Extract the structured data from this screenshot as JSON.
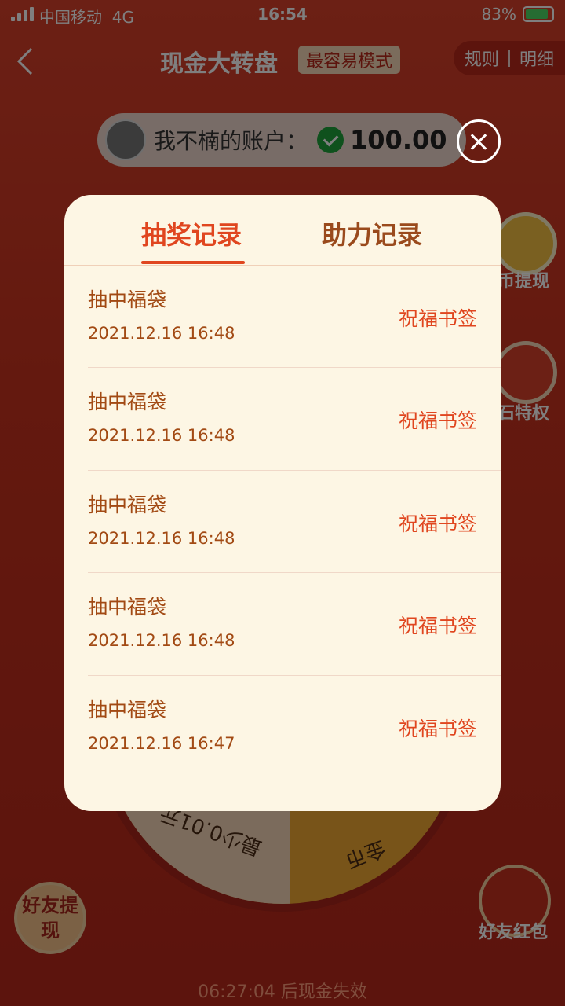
{
  "status_bar": {
    "carrier": "中国移动",
    "network": "4G",
    "time": "16:54",
    "battery": "83%"
  },
  "nav": {
    "title": "现金大转盘",
    "mode_badge": "最容易模式",
    "rules": "规则",
    "details": "明细"
  },
  "account": {
    "label": "我不楠的账户：",
    "amount": "100.00"
  },
  "background": {
    "side_label_1": "币提现",
    "side_label_2": "石特权",
    "wheel_text_1": "最少0.01元",
    "wheel_text_2": "金币",
    "friend_withdraw": "好友提现",
    "friend_redpack": "好友红包",
    "countdown": "06:27:04 后现金失效"
  },
  "modal": {
    "tabs": [
      "抽奖记录",
      "助力记录"
    ],
    "records": [
      {
        "title": "抽中福袋",
        "time": "2021.12.16 16:48",
        "prize": "祝福书签"
      },
      {
        "title": "抽中福袋",
        "time": "2021.12.16 16:48",
        "prize": "祝福书签"
      },
      {
        "title": "抽中福袋",
        "time": "2021.12.16 16:48",
        "prize": "祝福书签"
      },
      {
        "title": "抽中福袋",
        "time": "2021.12.16 16:48",
        "prize": "祝福书签"
      },
      {
        "title": "抽中福袋",
        "time": "2021.12.16 16:47",
        "prize": "祝福书签"
      }
    ]
  },
  "colors": {
    "accent": "#e0461f",
    "text_brown": "#a24a14",
    "modal_bg": "#fdf6e4"
  }
}
